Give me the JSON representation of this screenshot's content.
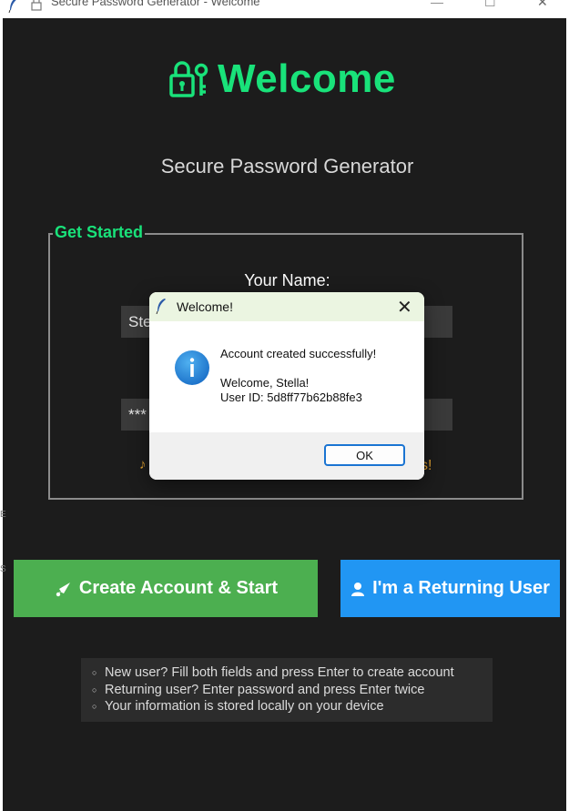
{
  "window": {
    "title": "Secure Password Generator - Welcome",
    "minimize_symbol": "—",
    "maximize_symbol": "☐",
    "close_symbol": "✕"
  },
  "header": {
    "title": "Welcome",
    "subtitle": "Secure Password Generator",
    "accent_color": "#19e27a"
  },
  "form": {
    "legend": "Get Started",
    "name_label": "Your Name:",
    "name_value": "Ste",
    "password_value": "***",
    "hint_left_fragment": "♪",
    "hint_right_fragment": "s!"
  },
  "buttons": {
    "create_label": "Create Account & Start",
    "returning_label": "I'm a Returning User",
    "create_color": "#4caf50",
    "returning_color": "#2196f3"
  },
  "tips": [
    "New user? Fill both fields and press Enter to create account",
    "Returning user? Enter password and press Enter twice",
    "Your information is stored locally on your device"
  ],
  "left_edge": {
    "mark1": "E",
    "mark2": "S"
  },
  "dialog": {
    "title": "Welcome!",
    "close_symbol": "✕",
    "line1": "Account created successfully!",
    "line2": "Welcome, Stella!",
    "line3": "User ID: 5d8ff77b62b88fe3",
    "ok_label": "OK",
    "info_icon_color": "#1a7fd4"
  }
}
